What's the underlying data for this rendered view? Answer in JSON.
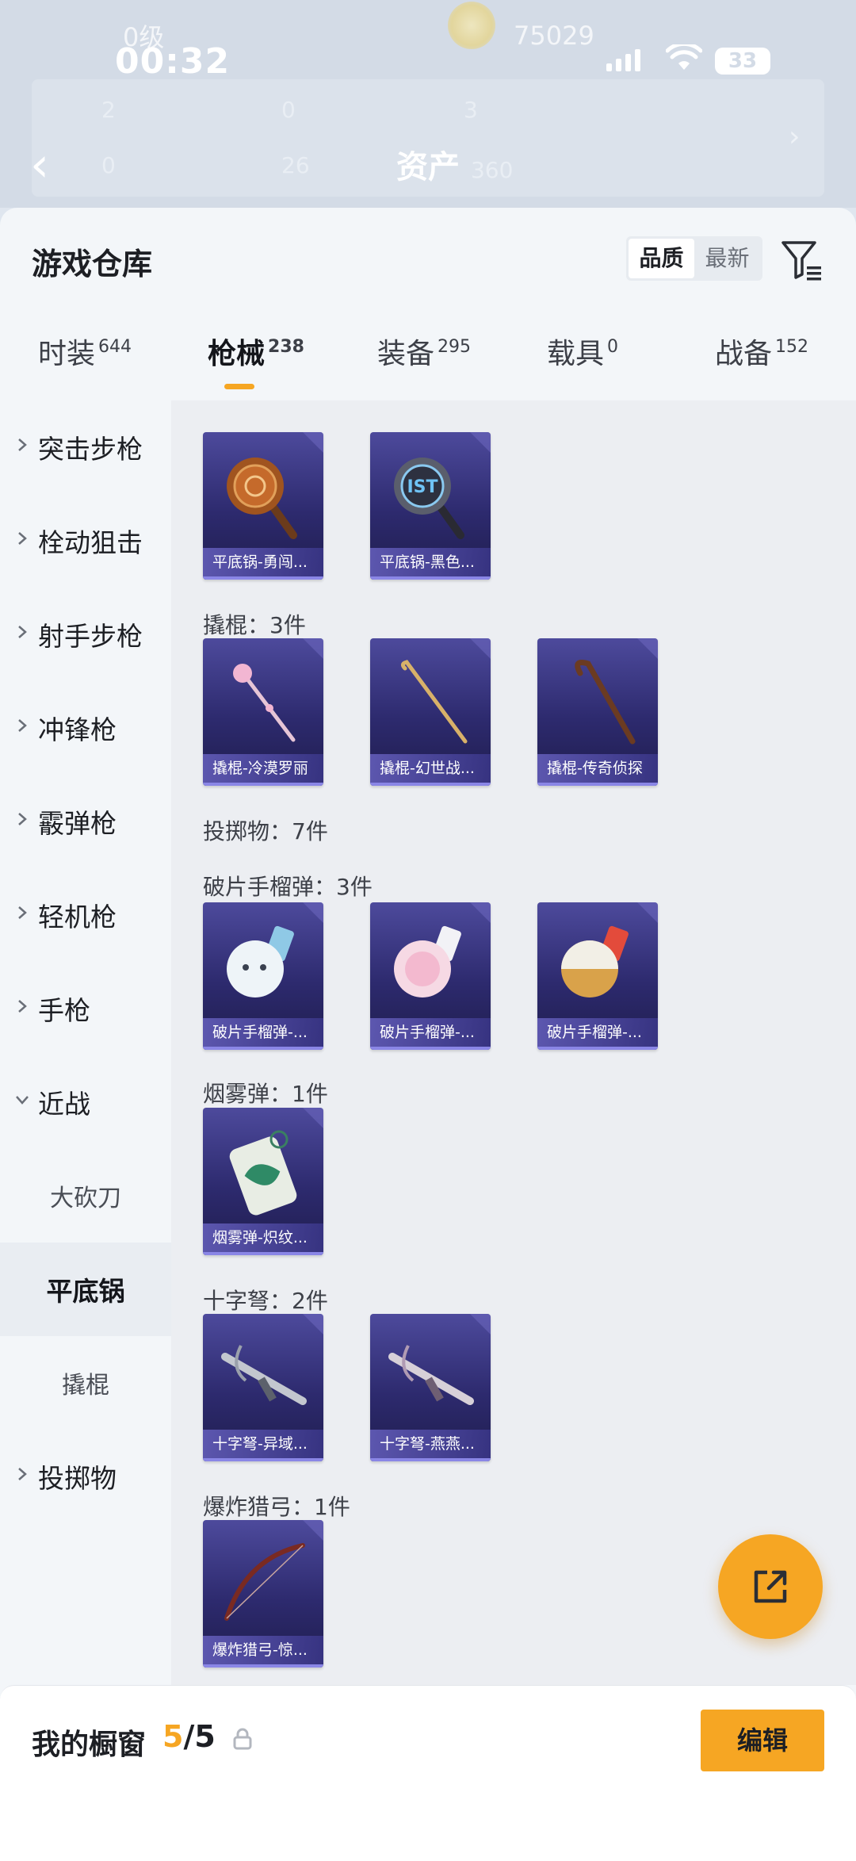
{
  "status_bar": {
    "level": "0级",
    "time": "00:32",
    "coins": "75029",
    "battery": "33"
  },
  "background_header": {
    "stats": [
      "2",
      "0",
      "3",
      "0",
      "26",
      "360"
    ],
    "assets_label": "资产"
  },
  "sheet": {
    "title": "游戏仓库",
    "sort_options": [
      "品质",
      "最新"
    ],
    "active_sort": "品质"
  },
  "tabs": [
    {
      "label": "时装",
      "count": "644"
    },
    {
      "label": "枪械",
      "count": "238",
      "active": true
    },
    {
      "label": "装备",
      "count": "295"
    },
    {
      "label": "载具",
      "count": "0"
    },
    {
      "label": "战备",
      "count": "152"
    }
  ],
  "sidebar": {
    "categories": [
      "突击步枪",
      "栓动狙击",
      "射手步枪",
      "冲锋枪",
      "霰弹枪",
      "轻机枪",
      "手枪",
      "近战"
    ],
    "subcategories": [
      "大砍刀",
      "平底锅",
      "撬棍"
    ],
    "active_sub": "平底锅",
    "last_category": "投掷物"
  },
  "content": {
    "pan_items": [
      "平底锅-勇闯...",
      "平底锅-黑色..."
    ],
    "crowbar_title": "撬棍：3件",
    "crowbar_items": [
      "撬棍-冷漠罗丽",
      "撬棍-幻世战...",
      "撬棍-传奇侦探"
    ],
    "throwables_title": "投掷物：7件",
    "grenade_title": "破片手榴弹：3件",
    "grenade_items": [
      "破片手榴弹-...",
      "破片手榴弹-...",
      "破片手榴弹-..."
    ],
    "smoke_title": "烟雾弹：1件",
    "smoke_items": [
      "烟雾弹-炽纹..."
    ],
    "crossbow_title": "十字弩：2件",
    "crossbow_items": [
      "十字弩-异域...",
      "十字弩-燕燕..."
    ],
    "bow_title": "爆炸猎弓：1件",
    "bow_items": [
      "爆炸猎弓-惊..."
    ]
  },
  "bottom_bar": {
    "label": "我的橱窗",
    "current": "5",
    "total": "/5",
    "edit_label": "编辑"
  }
}
